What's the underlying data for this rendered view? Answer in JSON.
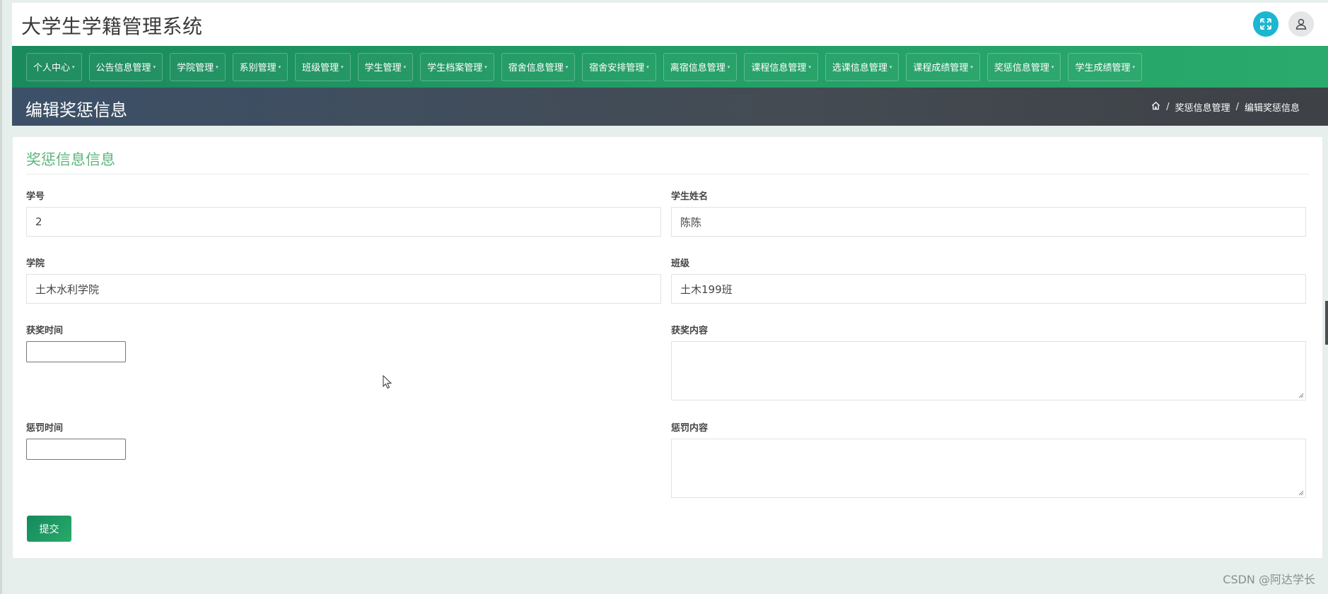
{
  "app": {
    "title": "大学生学籍管理系统"
  },
  "header": {
    "expand_icon": "expand-icon",
    "user_icon": "user-icon"
  },
  "nav": {
    "items": [
      {
        "label": "个人中心"
      },
      {
        "label": "公告信息管理"
      },
      {
        "label": "学院管理"
      },
      {
        "label": "系别管理"
      },
      {
        "label": "班级管理"
      },
      {
        "label": "学生管理"
      },
      {
        "label": "学生档案管理"
      },
      {
        "label": "宿舍信息管理"
      },
      {
        "label": "宿舍安排管理"
      },
      {
        "label": "离宿信息管理"
      },
      {
        "label": "课程信息管理"
      },
      {
        "label": "选课信息管理"
      },
      {
        "label": "课程成绩管理"
      },
      {
        "label": "奖惩信息管理"
      },
      {
        "label": "学生成绩管理"
      }
    ]
  },
  "page": {
    "title": "编辑奖惩信息",
    "breadcrumb": {
      "home_icon": "home-icon",
      "separator": "/",
      "level1": "奖惩信息管理",
      "level2": "编辑奖惩信息"
    }
  },
  "form": {
    "card_title": "奖惩信息信息",
    "student_id": {
      "label": "学号",
      "value": "2"
    },
    "student_name": {
      "label": "学生姓名",
      "value": "陈陈"
    },
    "college": {
      "label": "学院",
      "value": "土木水利学院"
    },
    "class": {
      "label": "班级",
      "value": "土木199班"
    },
    "award_time": {
      "label": "获奖时间",
      "value": ""
    },
    "award_content": {
      "label": "获奖内容",
      "value": ""
    },
    "punish_time": {
      "label": "惩罚时间",
      "value": ""
    },
    "punish_content": {
      "label": "惩罚内容",
      "value": ""
    },
    "submit_label": "提交"
  },
  "watermark": "CSDN @阿达学长",
  "colors": {
    "nav_green": "#229e66",
    "accent_green": "#5cb67b",
    "title_bar": "#444b52",
    "expand_cyan": "#1bb7d1"
  }
}
